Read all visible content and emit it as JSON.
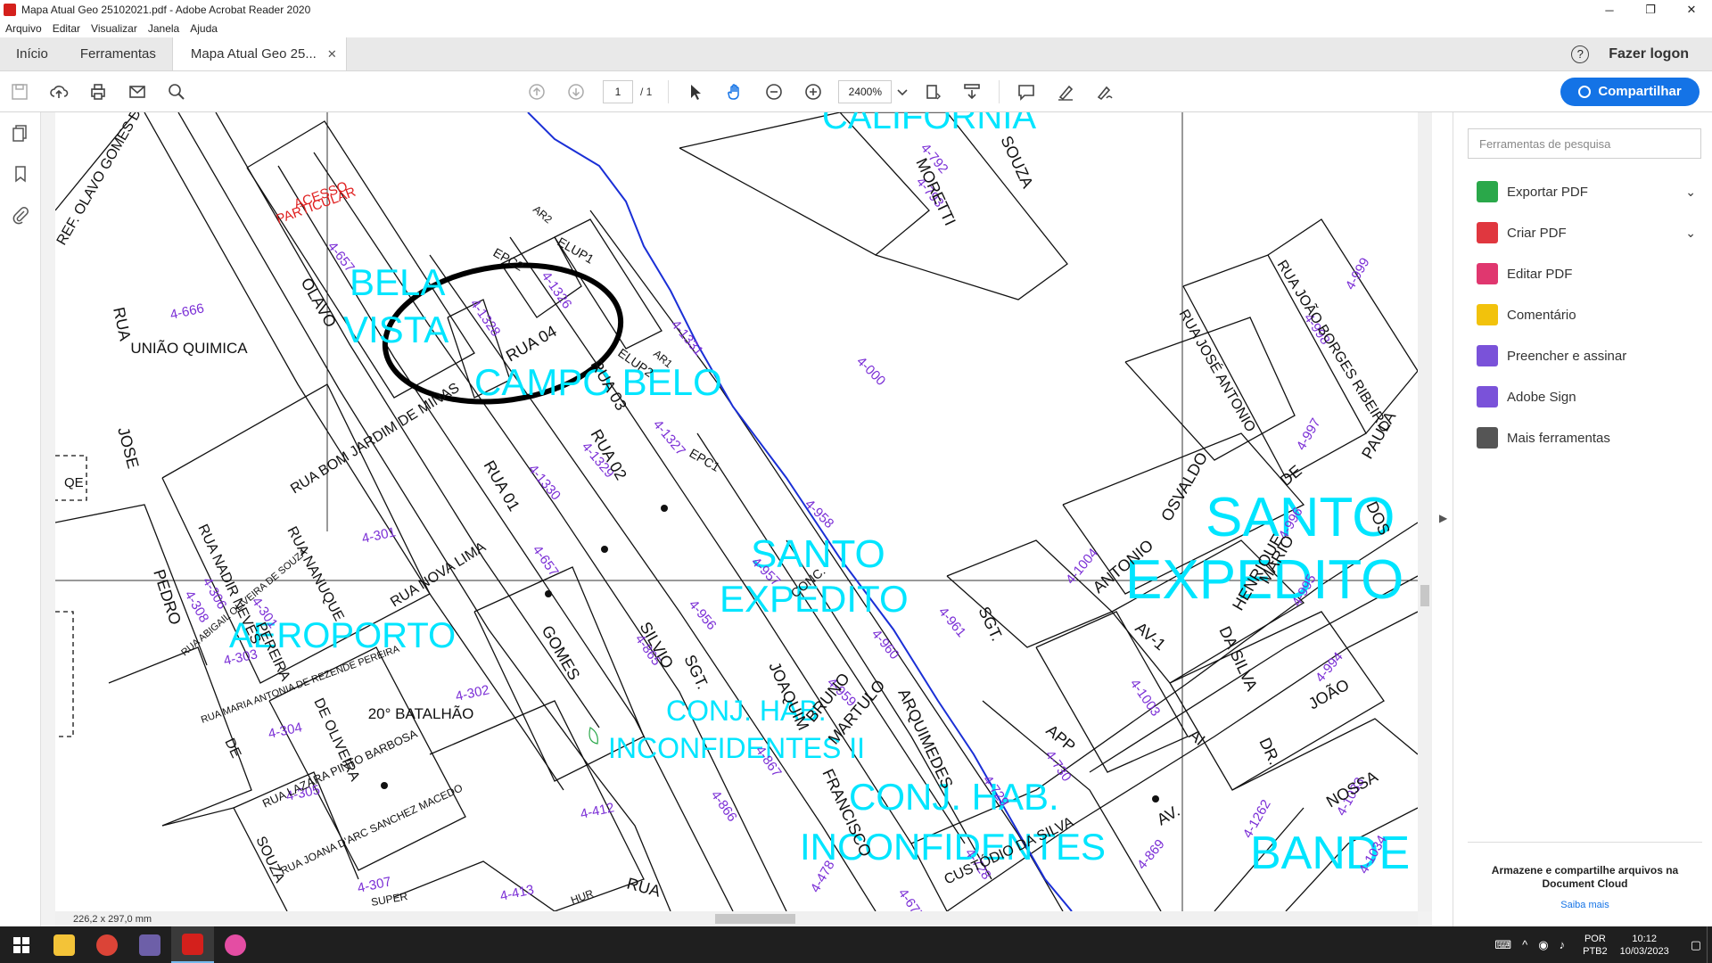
{
  "window": {
    "title": "Mapa Atual Geo 25102021.pdf - Adobe Acrobat Reader 2020",
    "minimize": "─",
    "restore": "❐",
    "close": "✕"
  },
  "menu": [
    "Arquivo",
    "Editar",
    "Visualizar",
    "Janela",
    "Ajuda"
  ],
  "tabs": {
    "home": "Início",
    "tools": "Ferramentas",
    "document": "Mapa Atual Geo 25...",
    "document_close": "✕",
    "help": "?",
    "login": "Fazer logon"
  },
  "toolbar": {
    "page_current": "1",
    "page_total": "/ 1",
    "zoom": "2400%",
    "share_label": "Compartilhar"
  },
  "map": {
    "neighborhoods": [
      {
        "text": "CALIFORNIA"
      },
      {
        "text": "BELA"
      },
      {
        "text": "VISTA"
      },
      {
        "text": "CAMPO BELO"
      },
      {
        "text": "SANTO"
      },
      {
        "text": "EXPEDITO"
      },
      {
        "text": "SANTO"
      },
      {
        "text": "EXPEDITO"
      },
      {
        "text": "AEROPORTO"
      },
      {
        "text": "CONJ. HAB."
      },
      {
        "text": "INCONFIDENTES II"
      },
      {
        "text": "CONJ. HAB."
      },
      {
        "text": "INCONFIDENTES"
      },
      {
        "text": "BANDE"
      }
    ],
    "lots": [
      "4-657",
      "4-666",
      "4-1328",
      "4-1326",
      "4-1331",
      "4-000",
      "4-792",
      "4-793",
      "4-1327",
      "4-1329",
      "4-1330",
      "4-301",
      "4-958",
      "4-957",
      "4-956",
      "4-865",
      "4-960",
      "4-961",
      "4-959",
      "4-306",
      "4-308",
      "4-303",
      "4-304",
      "4-305",
      "4-302",
      "4-412",
      "4-413",
      "4-307",
      "4-1004",
      "4-1003",
      "4-730",
      "4-869",
      "4-1262",
      "4-1033",
      "4-1034",
      "4-994",
      "4-995",
      "4-996",
      "4-997",
      "4-998",
      "4-999",
      "4-866",
      "4-867",
      "4-677",
      "4-478",
      "4-729",
      "4-728",
      "4-301",
      "4-657"
    ],
    "streets": [
      "RUA 04",
      "RUA 03",
      "RUA 02",
      "RUA 01",
      "ELUP1",
      "ELUP2",
      "EPC2",
      "EPC1",
      "AR2",
      "AR1",
      "OLAVO",
      "GOMES",
      "RUA",
      "JOSE",
      "PEDRO",
      "MORETTI",
      "SOUZA",
      "RUA BOM JARDIM DE MINAS",
      "RUA NOVA LIMA",
      "RUA NANUQUE",
      "RUA NADIR NEVES",
      "PEREIRA",
      "DE OLIVEIRA",
      "SILVIO",
      "SGT.",
      "JOAQUIM",
      "BRUNO",
      "MARTULO",
      "FRANCISCO",
      "ARQUIMEDES",
      "APP",
      "AV-1",
      "AI",
      "CUSTÓDIO DA SILVA",
      "RUA JOÃO BORGES RIBEIRO",
      "RUA JOSÉ ANTONIO",
      "OSVALDO",
      "HENRIQUE",
      "MARIO",
      "DA SILVA",
      "DR.",
      "JOÃO",
      "NOSSA",
      "PAULA",
      "DOS",
      "DE",
      "AV.",
      "ANTONIO",
      "REF. OLAVO GOMES DE OLIVEIRA",
      "SOUZA",
      "DE",
      "RUA LAZARA PINTO BARBOSA",
      "RUA JOANA D'ARC SANCHEZ MACEDO",
      "RUA MARIA ANTONIA DE REZENDE PEREIRA",
      "RUA ABIGAIL OLIVEIRA DE SOUZA",
      "SUPER",
      "HUR",
      "RUA",
      "CONC.",
      "SGT."
    ],
    "places": [
      "UNIÃO QUIMICA",
      "20° BATALHÃO",
      "QE"
    ],
    "restricted": [
      "ACESSO",
      "PARTICULAR"
    ],
    "page_size": "226,2 x 297,0 mm"
  },
  "right_panel": {
    "search_placeholder": "Ferramentas de pesquisa",
    "tools": [
      {
        "label": "Exportar PDF",
        "color": "#2aa84a",
        "expand": "⌄"
      },
      {
        "label": "Criar PDF",
        "color": "#e0373f",
        "expand": "⌄"
      },
      {
        "label": "Editar PDF",
        "color": "#e0376f"
      },
      {
        "label": "Comentário",
        "color": "#f2c20c"
      },
      {
        "label": "Preencher e assinar",
        "color": "#7a52d9"
      },
      {
        "label": "Adobe Sign",
        "color": "#7a52d9"
      },
      {
        "label": "Mais ferramentas",
        "color": "#555555"
      }
    ],
    "promo_text": "Armazene e compartilhe arquivos na Document Cloud",
    "promo_link": "Saiba mais"
  },
  "taskbar": {
    "lang_top": "POR",
    "lang_bottom": "PTB2",
    "time": "10:12",
    "date": "10/03/2023"
  },
  "colors": {
    "accent": "#1473e6",
    "neighborhood": "#00e5ff",
    "lot": "#7b2fd6",
    "water": "#1a2fd6",
    "restricted": "#e02020"
  }
}
